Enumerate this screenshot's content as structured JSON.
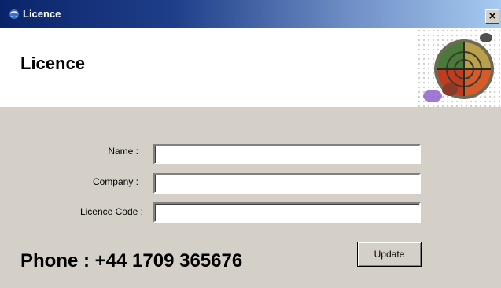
{
  "window": {
    "title": "Licence",
    "close_label": "×"
  },
  "header": {
    "title": "Licence",
    "logo_icon": "globe-logo-icon"
  },
  "form": {
    "fields": [
      {
        "label": "Name :",
        "value": ""
      },
      {
        "label": "Company :",
        "value": ""
      },
      {
        "label": "Licence Code :",
        "value": ""
      }
    ],
    "update_label": "Update"
  },
  "phone_text": "Phone : +44 1709 365676",
  "colors": {
    "titlebar_start": "#0a246a",
    "titlebar_end": "#a6caf0",
    "panel": "#d4d0c8"
  }
}
